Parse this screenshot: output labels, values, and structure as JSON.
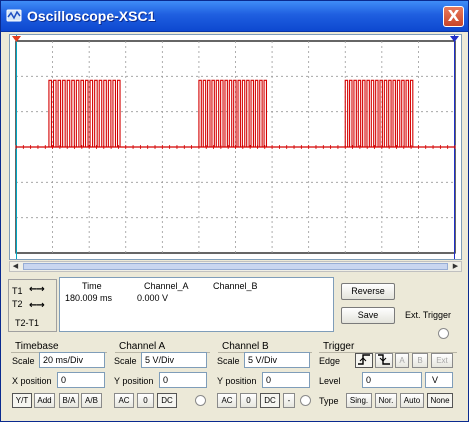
{
  "window": {
    "title": "Oscilloscope-XSC1",
    "close_label": "X"
  },
  "colors": {
    "trace": "#d40000",
    "cursor1": "#00a7c4",
    "cursor2": "#1f2fc8",
    "grid": "#9a9a9a"
  },
  "cursors": {
    "t1_label": "T1",
    "t2_label": "T2",
    "diff_label": "T2-T1",
    "left_arrow": "←",
    "right_arrow": "→"
  },
  "readout": {
    "headers": {
      "time": "Time",
      "channel_a": "Channel_A",
      "channel_b": "Channel_B"
    },
    "t1": {
      "time": "180.009 ms",
      "channel_a": "0.000 V",
      "channel_b": ""
    }
  },
  "side_buttons": {
    "reverse": "Reverse",
    "save": "Save",
    "ext_trigger": "Ext. Trigger"
  },
  "timebase": {
    "title": "Timebase",
    "scale_label": "Scale",
    "scale": "20 ms/Div",
    "xpos_label": "X position",
    "xpos": "0",
    "modes": [
      "Y/T",
      "Add",
      "B/A",
      "A/B"
    ]
  },
  "channel_a": {
    "title": "Channel A",
    "scale_label": "Scale",
    "scale": "5  V/Div",
    "ypos_label": "Y position",
    "ypos": "0",
    "coupling": [
      "AC",
      "0",
      "DC"
    ]
  },
  "channel_b": {
    "title": "Channel B",
    "scale_label": "Scale",
    "scale": "5  V/Div",
    "ypos_label": "Y position",
    "ypos": "0",
    "coupling": [
      "AC",
      "0",
      "DC",
      "-"
    ]
  },
  "trigger": {
    "title": "Trigger",
    "edge_label": "Edge",
    "edge_buttons": [
      "A",
      "B",
      "Ext"
    ],
    "level_label": "Level",
    "level": "0",
    "level_unit": "V",
    "type_label": "Type",
    "types": [
      "Sing.",
      "Nor.",
      "Auto",
      "None"
    ]
  },
  "signal": {
    "description_units": "divisions",
    "bursts": [
      {
        "start_div": 0.9,
        "end_div": 2.9
      },
      {
        "start_div": 5.0,
        "end_div": 6.9
      },
      {
        "start_div": 9.0,
        "end_div": 10.9
      }
    ],
    "pulses_per_burst": 16,
    "high_level_div": 2,
    "baseline_div": 0
  }
}
